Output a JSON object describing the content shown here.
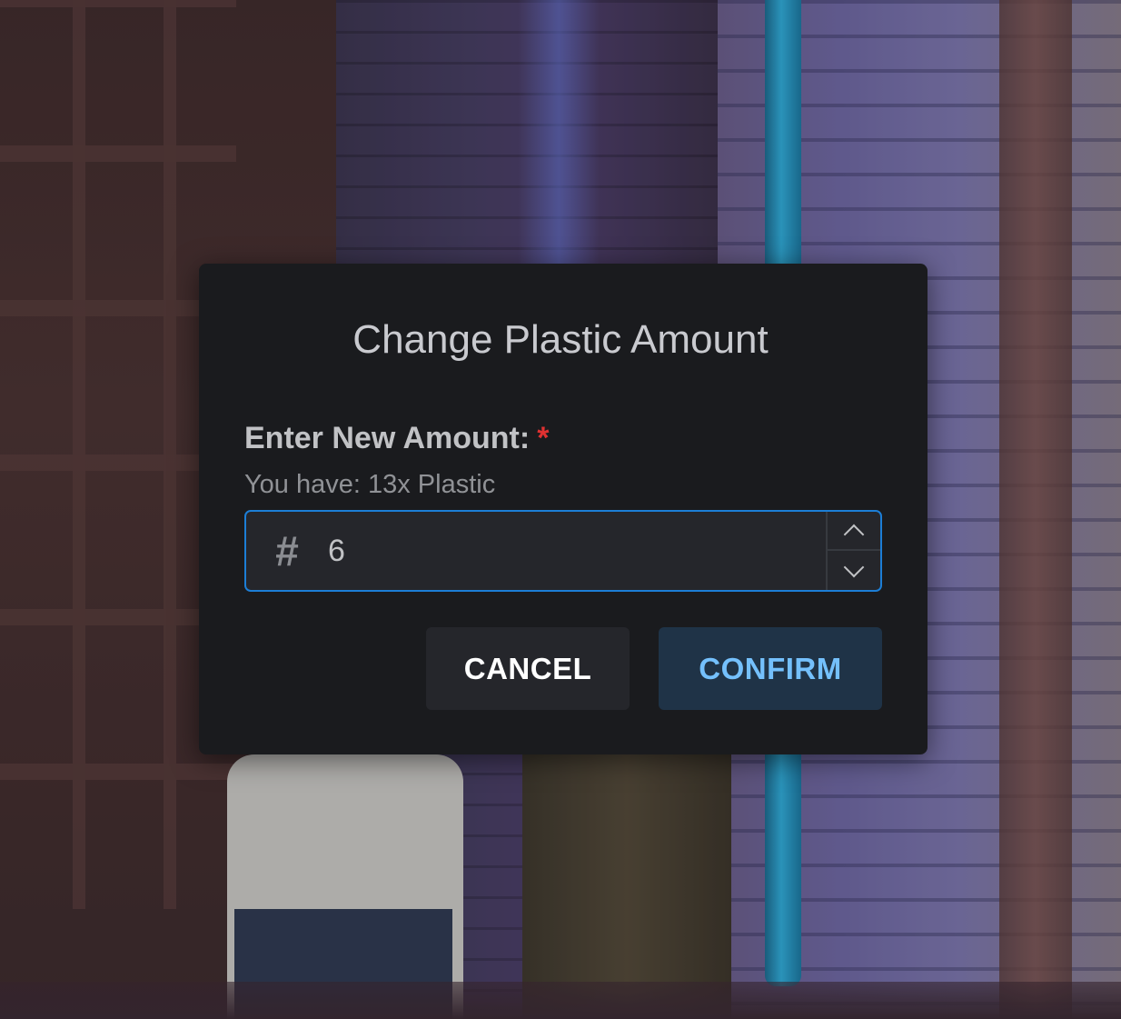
{
  "dialog": {
    "title": "Change Plastic Amount",
    "field_label": "Enter New Amount:",
    "required_mark": "*",
    "description": "You have: 13x Plastic",
    "input_value": "6",
    "input_icon": "hash-icon",
    "input_icon_glyph": "#",
    "cancel_label": "CANCEL",
    "confirm_label": "CONFIRM"
  },
  "colors": {
    "modal_bg": "#1a1b1e",
    "input_border": "#1c7ed6",
    "required": "#e03131",
    "confirm_text": "#74c0fc",
    "confirm_bg": "#1f3347"
  }
}
